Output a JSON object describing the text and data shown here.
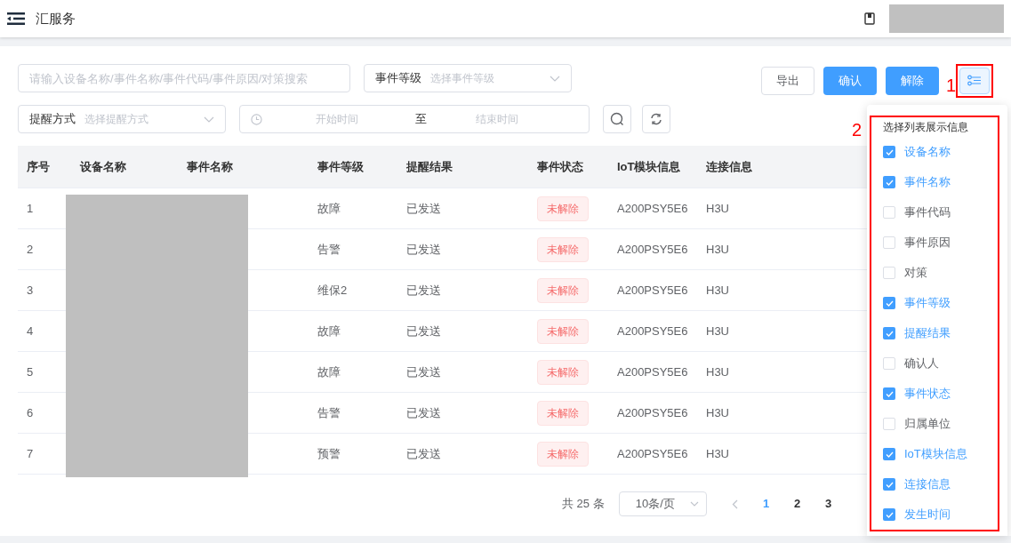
{
  "header": {
    "title": "汇服务"
  },
  "filters": {
    "search": {
      "placeholder": "请输入设备名称/事件名称/事件代码/事件原因/对策搜索"
    },
    "level_select": {
      "label": "事件等级",
      "placeholder": "选择事件等级"
    },
    "remind_select": {
      "label": "提醒方式",
      "placeholder": "选择提醒方式"
    },
    "date_range": {
      "start_placeholder": "开始时间",
      "separator": "至",
      "end_placeholder": "结束时间"
    }
  },
  "actions": [
    {
      "label": "导出",
      "kind": "plain"
    },
    {
      "label": "确认",
      "kind": "primary"
    },
    {
      "label": "解除",
      "kind": "primary"
    }
  ],
  "annotations": [
    "1",
    "2"
  ],
  "table": {
    "columns": [
      "序号",
      "设备名称",
      "事件名称",
      "事件等级",
      "提醒结果",
      "事件状态",
      "IoT模块信息",
      "连接信息"
    ],
    "rows": [
      {
        "index": "1",
        "level": "故障",
        "remind": "已发送",
        "status": "未解除",
        "iot": "A200PSY5E6",
        "connection": "H3U"
      },
      {
        "index": "2",
        "level": "告警",
        "remind": "已发送",
        "status": "未解除",
        "iot": "A200PSY5E6",
        "connection": "H3U"
      },
      {
        "index": "3",
        "level": "维保2",
        "remind": "已发送",
        "status": "未解除",
        "iot": "A200PSY5E6",
        "connection": "H3U"
      },
      {
        "index": "4",
        "level": "故障",
        "remind": "已发送",
        "status": "未解除",
        "iot": "A200PSY5E6",
        "connection": "H3U"
      },
      {
        "index": "5",
        "level": "故障",
        "remind": "已发送",
        "status": "未解除",
        "iot": "A200PSY5E6",
        "connection": "H3U"
      },
      {
        "index": "6",
        "level": "告警",
        "remind": "已发送",
        "status": "未解除",
        "iot": "A200PSY5E6",
        "connection": "H3U"
      },
      {
        "index": "7",
        "level": "预警",
        "remind": "已发送",
        "status": "未解除",
        "iot": "A200PSY5E6",
        "connection": "H3U"
      }
    ]
  },
  "pagination": {
    "total": "共 25 条",
    "page_size": "10条/页",
    "pages": [
      {
        "label": "1",
        "selected": true
      },
      {
        "label": "2",
        "selected": false
      },
      {
        "label": "3",
        "selected": false
      }
    ]
  },
  "column_picker": {
    "title": "选择列表展示信息",
    "items": [
      {
        "label": "设备名称",
        "checked": true
      },
      {
        "label": "事件名称",
        "checked": true
      },
      {
        "label": "事件代码",
        "checked": false
      },
      {
        "label": "事件原因",
        "checked": false
      },
      {
        "label": "对策",
        "checked": false
      },
      {
        "label": "事件等级",
        "checked": true
      },
      {
        "label": "提醒结果",
        "checked": true
      },
      {
        "label": "确认人",
        "checked": false
      },
      {
        "label": "事件状态",
        "checked": true
      },
      {
        "label": "归属单位",
        "checked": false
      },
      {
        "label": "IoT模块信息",
        "checked": true
      },
      {
        "label": "连接信息",
        "checked": true
      },
      {
        "label": "发生时间",
        "checked": true
      }
    ]
  }
}
